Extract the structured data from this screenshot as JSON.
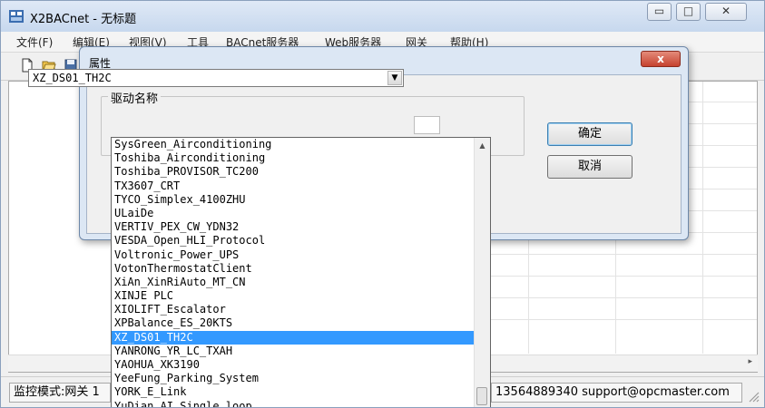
{
  "window": {
    "title": "X2BACnet - 无标题",
    "controls": {
      "minimize": "▭",
      "maximize": "□",
      "close": "✕"
    }
  },
  "menu": [
    "文件(F)",
    "编辑(E)",
    "视图(V)",
    "工具",
    "BACnet服务器",
    "Web服务器",
    "网关",
    "帮助(H)"
  ],
  "toolbar": [
    "new-file-icon",
    "open-folder-icon",
    "save-icon"
  ],
  "dialog": {
    "title": "属性",
    "close_label": "x",
    "group_label": "驱动名称",
    "combo_value": "XZ_DS01_TH2C",
    "ok_label": "确定",
    "cancel_label": "取消"
  },
  "dropdown": {
    "items": [
      "SysGreen_Airconditioning",
      "Toshiba_Airconditioning",
      "Toshiba_PROVISOR_TC200",
      "TX3607_CRT",
      "TYCO_Simplex_4100ZHU",
      "ULaiDe",
      "VERTIV_PEX_CW_YDN32",
      "VESDA_Open_HLI_Protocol",
      "Voltronic_Power_UPS",
      "VotonThermostatClient",
      "XiAn_XinRiAuto_MT_CN",
      "XINJE PLC",
      "XIOLIFT_Escalator",
      "XPBalance_ES_20KTS",
      "XZ_DS01_TH2C",
      "YANRONG_YR_LC_TXAH",
      "YAOHUA_XK3190",
      "YeeFung_Parking_System",
      "YORK_E_Link",
      "YuDian_AI_Single_loop"
    ],
    "selected_index": 14
  },
  "status": {
    "mode": "监控模式:网关 1",
    "contact": "13564889340 support@opcmaster.com"
  },
  "colors": {
    "selection": "#3399ff",
    "titlebar": "#c7d8ee",
    "dialog_close": "#c5422f"
  }
}
